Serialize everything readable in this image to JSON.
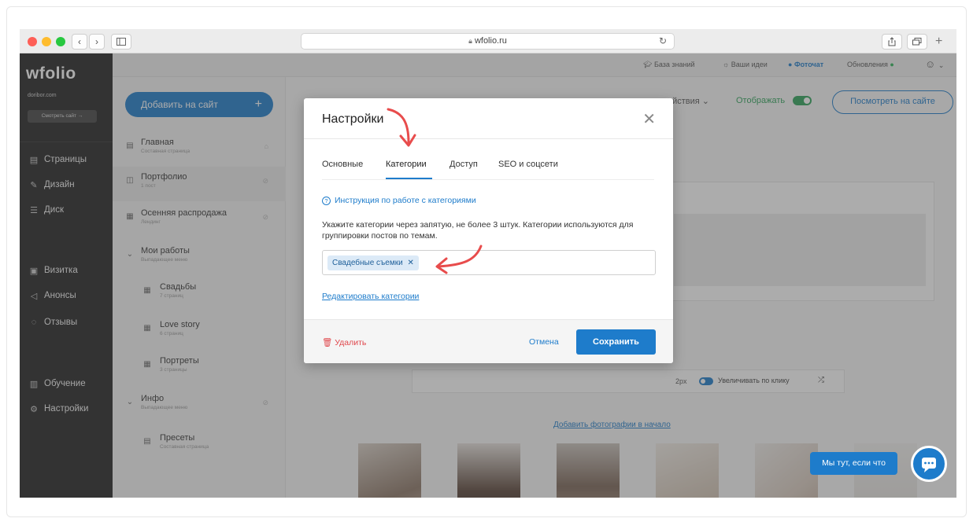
{
  "browser": {
    "url": "wfolio.ru",
    "nav_back": "‹",
    "nav_forward": "›"
  },
  "sidebar": {
    "logo": "wfolio",
    "domain": "doribor.com",
    "view_site": "Смотреть сайт →",
    "items": [
      {
        "label": "Страницы",
        "icon": "page-icon"
      },
      {
        "label": "Дизайн",
        "icon": "brush-icon"
      },
      {
        "label": "Диск",
        "icon": "disk-icon"
      },
      {
        "label": "Визитка",
        "icon": "card-icon"
      },
      {
        "label": "Анонсы",
        "icon": "megaphone-icon"
      },
      {
        "label": "Отзывы",
        "icon": "reviews-icon"
      },
      {
        "label": "Обучение",
        "icon": "book-icon"
      },
      {
        "label": "Настройки",
        "icon": "gear-icon"
      }
    ]
  },
  "topbar": {
    "knowledge": "База знаний",
    "ideas": "Ваши идеи",
    "photochat": "Фоточат",
    "updates": "Обновления"
  },
  "pagelist": {
    "add_button": "Добавить на сайт",
    "add_plus": "+",
    "items": [
      {
        "title": "Главная",
        "sub": "Составная страница"
      },
      {
        "title": "Портфолио",
        "sub": "1 пост"
      },
      {
        "title": "Осенняя распродажа",
        "sub": "Лендинг"
      },
      {
        "title": "Мои работы",
        "sub": "Выпадающее меню"
      },
      {
        "title": "Свадьбы",
        "sub": "7 страниц"
      },
      {
        "title": "Love story",
        "sub": "6 страниц"
      },
      {
        "title": "Портреты",
        "sub": "3 страницы"
      },
      {
        "title": "Инфо",
        "sub": "Выпадающее меню"
      },
      {
        "title": "Пресеты",
        "sub": "Составная страница"
      }
    ]
  },
  "main": {
    "actions": "ействия ⌄",
    "show": "Отображать",
    "view_on_site": "Посмотреть на сайте",
    "spacing": "2px",
    "zoom_click": "Увеличивать по клику",
    "add_photos_start": "Добавить фотографии в начало"
  },
  "modal": {
    "title": "Настройки",
    "tabs": [
      "Основные",
      "Категории",
      "Доступ",
      "SEO и соцсети"
    ],
    "help_link": "Инструкция по работе с категориями",
    "description": "Укажите категории через запятую, не более 3 штук. Категории используются для группировки постов по темам.",
    "tag": "Свадебные съемки",
    "tag_remove": "✕",
    "edit_categories": "Редактировать категории",
    "delete": "Удалить",
    "cancel": "Отмена",
    "save": "Сохранить"
  },
  "chat": {
    "pill": "Мы тут, если что"
  },
  "colors": {
    "accent": "#1e7ccb",
    "danger": "#e0474c",
    "sidebar_bg": "#232323",
    "annotation_arrow": "#e84c4c"
  }
}
